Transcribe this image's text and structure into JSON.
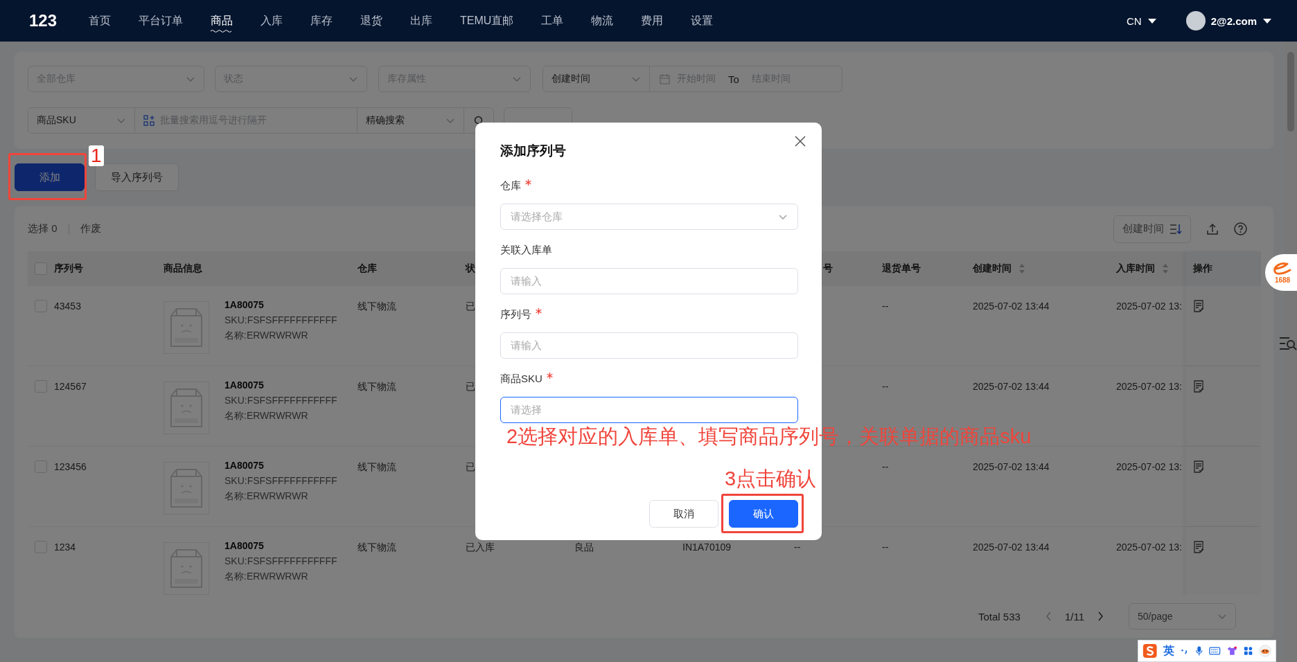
{
  "nav": {
    "logo": "123",
    "items": [
      {
        "label": "首页",
        "selected": false
      },
      {
        "label": "平台订单",
        "selected": false
      },
      {
        "label": "商品",
        "selected": true
      },
      {
        "label": "入库",
        "selected": false
      },
      {
        "label": "库存",
        "selected": false
      },
      {
        "label": "退货",
        "selected": false
      },
      {
        "label": "出库",
        "selected": false
      },
      {
        "label": "TEMU直邮",
        "selected": false
      },
      {
        "label": "工单",
        "selected": false
      },
      {
        "label": "物流",
        "selected": false
      },
      {
        "label": "费用",
        "selected": false
      },
      {
        "label": "设置",
        "selected": false
      }
    ],
    "language": {
      "label": "CN",
      "expanded": false
    },
    "user": {
      "label": "2@2.com",
      "expanded": false
    }
  },
  "filters": {
    "warehouse": "全部仓库",
    "status": "状态",
    "stock_attr": "库存属性",
    "date_field": "创建时间",
    "start": "开始时间",
    "to": "To",
    "end": "结束时间",
    "search_field": "商品SKU",
    "search_placeholder": "批量搜索用逗号进行隔开",
    "match_mode": "精确搜索"
  },
  "actions": [
    {
      "label": "添加",
      "primary": true,
      "highlighted": true
    },
    {
      "label": "导入序列号",
      "primary": false,
      "highlighted": false
    }
  ],
  "table": {
    "select_label": "选择 0",
    "void": "作废",
    "sort": "创建时间",
    "all_checked": false,
    "columns": [
      {
        "header": "序列号",
        "sortable": false
      },
      {
        "header": "商品信息",
        "sortable": false
      },
      {
        "header": "仓库",
        "sortable": false
      },
      {
        "header": "状"
      },
      {
        "header": "号",
        "sortable": false
      },
      {
        "header": "退货单号",
        "sortable": false
      },
      {
        "header": "创建时间",
        "sortable": true
      },
      {
        "header": "入库时间",
        "sortable": true
      },
      {
        "header": "操作",
        "sortable": false
      }
    ],
    "rows": [
      {
        "checked": false,
        "serial": "43453",
        "code": "1A80075",
        "sku": "SKU:FSFSFFFFFFFFFFF",
        "name": "名称:ERWRWRWR",
        "warehouse": "线下物流",
        "status": "已",
        "return_no": "--",
        "created": "2025-07-02 13:44",
        "stocked": "2025-07-02 13:"
      },
      {
        "checked": false,
        "serial": "124567",
        "code": "1A80075",
        "sku": "SKU:FSFSFFFFFFFFFFF",
        "name": "名称:ERWRWRWR",
        "warehouse": "线下物流",
        "status": "已",
        "return_no": "--",
        "created": "2025-07-02 13:44",
        "stocked": "2025-07-02 13:"
      },
      {
        "checked": false,
        "serial": "123456",
        "code": "1A80075",
        "sku": "SKU:FSFSFFFFFFFFFFF",
        "name": "名称:ERWRWRWR",
        "warehouse": "线下物流",
        "status": "已",
        "return_no": "--",
        "created": "2025-07-02 13:44",
        "stocked": "2025-07-02 13:"
      },
      {
        "checked": false,
        "serial": "1234",
        "code": "1A80075",
        "sku": "SKU:FSFSFFFFFFFFFFF",
        "name": "名称:ERWRWRWR",
        "warehouse": "线下物流",
        "status": "已入库",
        "column_5": "良品",
        "column_6": "IN1A70109",
        "column_7": "--",
        "return_no": "--",
        "created": "2025-07-02 13:44",
        "stocked": "2025-07-02 13:"
      }
    ]
  },
  "pagination": {
    "total": "Total 533",
    "page": "1/11",
    "page_size": "50/page"
  },
  "modal": {
    "title": "添加序列号",
    "fields": [
      {
        "label": "仓库",
        "required": true,
        "kind": "select",
        "placeholder": "请选择仓库",
        "focused": false
      },
      {
        "label": "关联入库单",
        "required": false,
        "kind": "input",
        "placeholder": "请输入",
        "focused": false
      },
      {
        "label": "序列号",
        "required": true,
        "kind": "input",
        "placeholder": "请输入",
        "focused": false
      },
      {
        "label": "商品SKU",
        "required": true,
        "kind": "input",
        "placeholder": "请选择",
        "focused": true
      }
    ],
    "cancel": "取消",
    "confirm": "确认",
    "confirm_highlighted": true
  },
  "annotations": {
    "step1": "1",
    "step2": "2选择对应的入库单、填写商品序列号，关联单据的商品sku",
    "step3": "3点击确认"
  },
  "side_badge": "1688",
  "ime": {
    "language": "英"
  }
}
